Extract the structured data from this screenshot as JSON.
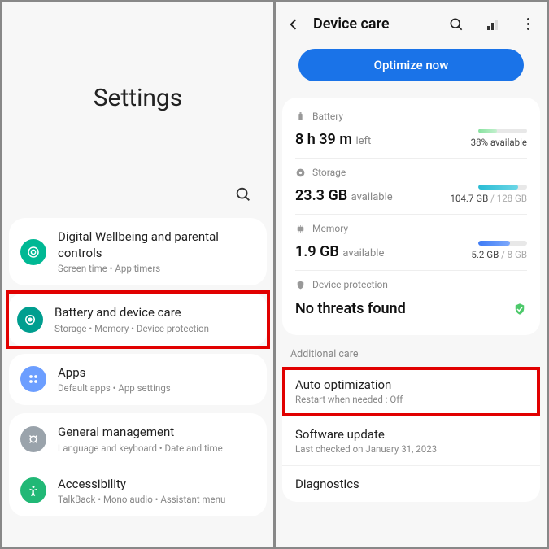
{
  "left": {
    "title": "Settings",
    "items": [
      {
        "label": "Digital Wellbeing and parental controls",
        "sub": "Screen time  •  App timers"
      },
      {
        "label": "Battery and device care",
        "sub": "Storage  •  Memory  •  Device protection"
      },
      {
        "label": "Apps",
        "sub": "Default apps  •  App settings"
      },
      {
        "label": "General management",
        "sub": "Language and keyboard  •  Date and time"
      },
      {
        "label": "Accessibility",
        "sub": "TalkBack  •  Mono audio  •  Assistant menu"
      }
    ]
  },
  "right": {
    "title": "Device care",
    "optimize_label": "Optimize now",
    "battery": {
      "head": "Battery",
      "main": "8 h 39 m",
      "suffix": "left",
      "pct": "38% available"
    },
    "storage": {
      "head": "Storage",
      "main": "23.3 GB",
      "suffix": "available",
      "used": "104.7 GB",
      "total": " / 128 GB"
    },
    "memory": {
      "head": "Memory",
      "main": "1.9 GB",
      "suffix": "available",
      "used": "5.2 GB",
      "total": " / 8 GB"
    },
    "protection": {
      "head": "Device protection",
      "status": "No threats found"
    },
    "additional_label": "Additional care",
    "care": [
      {
        "label": "Auto optimization",
        "sub": "Restart when needed : Off"
      },
      {
        "label": "Software update",
        "sub": "Last checked on January 31, 2023"
      },
      {
        "label": "Diagnostics",
        "sub": ""
      }
    ]
  }
}
